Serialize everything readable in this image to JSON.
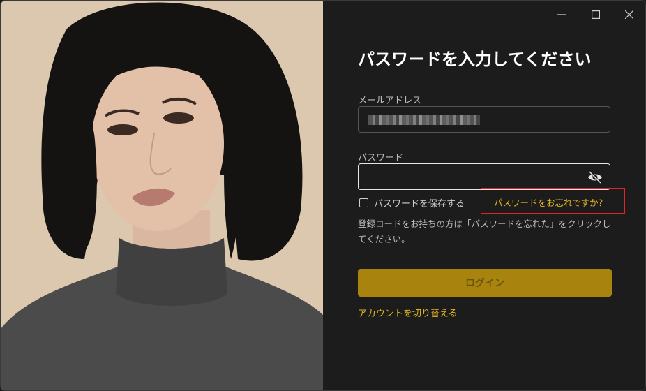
{
  "window": {
    "controls": [
      "minimize-icon",
      "maximize-icon",
      "close-icon"
    ]
  },
  "login": {
    "title": "パスワードを入力してください",
    "email_label": "メールアドレス",
    "password_label": "パスワード",
    "password_value": "",
    "remember_label": "パスワードを保存する",
    "remember_checked": false,
    "forgot_link": "パスワードをお忘れですか？",
    "hint": "登録コードをお持ちの方は「パスワードを忘れた」をクリックしてください。",
    "login_button": "ログイン",
    "switch_account": "アカウントを切り替える"
  },
  "colors": {
    "accent": "#e3b523",
    "button": "#a8840e",
    "highlight_box": "#e0262b",
    "background": "#1c1c1c"
  }
}
